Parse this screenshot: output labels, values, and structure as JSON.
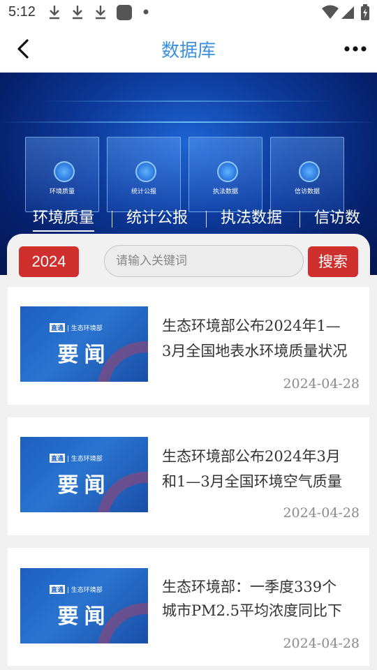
{
  "status_bar": {
    "time": "5:12"
  },
  "header": {
    "title": "数据库"
  },
  "banner": {
    "cards": [
      "环境质量",
      "统计公报",
      "执法数据",
      "信访数据"
    ],
    "tabs": [
      "环境质量",
      "统计公报",
      "执法数据",
      "信访数"
    ],
    "active_tab": 0
  },
  "filter": {
    "year": "2024",
    "search_placeholder": "请输入关键词",
    "search_button": "搜索"
  },
  "news": [
    {
      "thumb_badge_a": "直通",
      "thumb_badge_b": "生态环境部",
      "thumb_big": "要闻",
      "title_line1": "生态环境部公布2024年1—",
      "title_line2": "3月全国地表水环境质量状况",
      "date": "2024-04-28"
    },
    {
      "thumb_badge_a": "直通",
      "thumb_badge_b": "生态环境部",
      "thumb_big": "要闻",
      "title_line1": "生态环境部公布2024年3月",
      "title_line2": "和1—3月全国环境空气质量",
      "date": "2024-04-28"
    },
    {
      "thumb_badge_a": "直通",
      "thumb_badge_b": "生态环境部",
      "thumb_big": "要闻",
      "title_line1": "生态环境部：一季度339个",
      "title_line2": "城市PM2.5平均浓度同比下",
      "date": "2024-04-28"
    }
  ]
}
